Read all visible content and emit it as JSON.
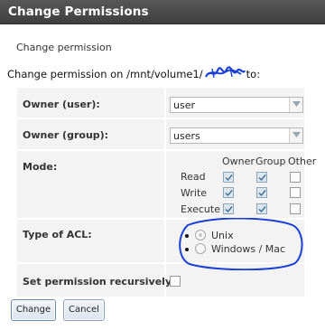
{
  "dialog": {
    "title": "Change Permissions",
    "subheading": "Change permission",
    "path_prefix": "Change permission on /mnt/volume1/",
    "path_suffix": "to:"
  },
  "form": {
    "owner_user": {
      "label": "Owner (user):",
      "value": "user"
    },
    "owner_group": {
      "label": "Owner (group):",
      "value": "users"
    },
    "mode": {
      "label": "Mode:",
      "columns": [
        "Owner",
        "Group",
        "Other"
      ],
      "rows": [
        {
          "name": "Read",
          "values": [
            true,
            true,
            false
          ]
        },
        {
          "name": "Write",
          "values": [
            true,
            true,
            false
          ]
        },
        {
          "name": "Execute",
          "values": [
            true,
            true,
            false
          ]
        }
      ]
    },
    "acl": {
      "label": "Type of ACL:",
      "options": [
        "Unix",
        "Windows / Mac"
      ],
      "selected": "Unix",
      "annotation_color": "#1a3fd6"
    },
    "recursive": {
      "label": "Set permission recursively:",
      "checked": false
    }
  },
  "buttons": {
    "change": "Change",
    "cancel": "Cancel"
  },
  "colors": {
    "titlebar": "#4a4a4a",
    "form_bg": "#f3f3f3",
    "button_border": "#8aa1bf"
  }
}
